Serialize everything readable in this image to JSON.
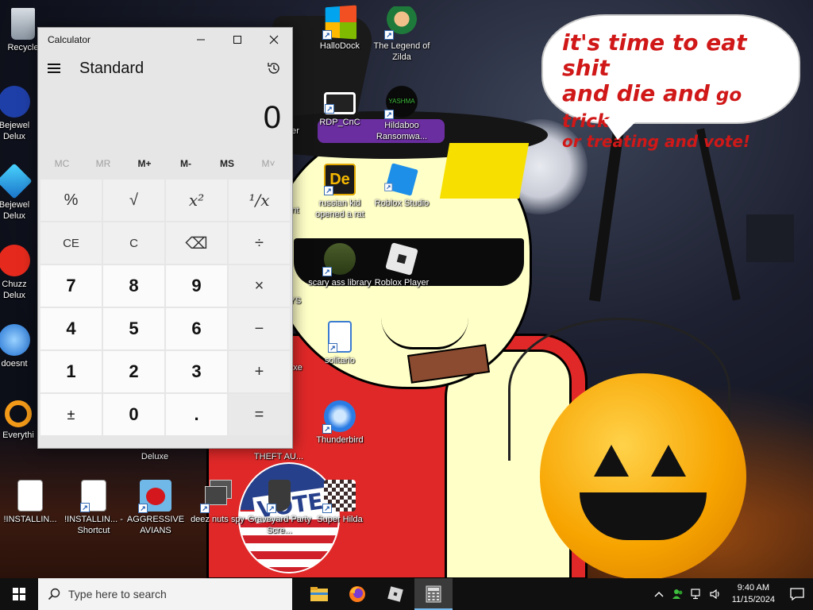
{
  "wallpaper": {
    "speech_line1": "it's time to eat shit",
    "speech_line2_a": "and die and",
    "speech_line2_b": " go trick",
    "speech_line3": "or treating and vote!",
    "vote_text": "VOTE"
  },
  "desktop_icons": [
    {
      "label": "Recycle",
      "icon": "recycle-bin-icon"
    },
    {
      "label": "Bejewel Delux",
      "icon": "bejeweled-icon"
    },
    {
      "label": "Bejewel Delux",
      "icon": "bejeweled-gem-icon"
    },
    {
      "label": "Chuzz Delux",
      "icon": "chuzzle-icon"
    },
    {
      "label": "doesnt",
      "icon": "thunderbird-icon"
    },
    {
      "label": "Everythi",
      "icon": "everything-search-icon"
    },
    {
      "label": "HalloDock",
      "icon": "windows-logo-icon"
    },
    {
      "label": "The Legend of Zilda",
      "icon": "zelda-character-icon"
    },
    {
      "label": "RDP_CnC",
      "icon": "rdp-monitor-icon"
    },
    {
      "label": "Hildaboo Ransomwa...",
      "icon": "yashma-ransomware-icon"
    },
    {
      "label": "russian kid opened a rat",
      "icon": "de-logo-icon"
    },
    {
      "label": "Roblox Studio",
      "icon": "roblox-studio-icon"
    },
    {
      "label": "scary ass library",
      "icon": "library-icon"
    },
    {
      "label": "Roblox Player",
      "icon": "roblox-player-icon"
    },
    {
      "label": "solitario",
      "icon": "solitaire-icon"
    },
    {
      "label": "Thunderbird",
      "icon": "thunderbird-icon"
    },
    {
      "label": "!INSTALLIN...",
      "icon": "text-document-icon"
    },
    {
      "label": "!INSTALLIN... - Shortcut",
      "icon": "text-document-icon"
    },
    {
      "label": "AGGRESSIVE AVIANS",
      "icon": "angry-birds-icon"
    },
    {
      "label": "deez nuts spy",
      "icon": "stacked-windows-icon"
    },
    {
      "label": "Graveyard Party Scre...",
      "icon": "graveyard-icon"
    },
    {
      "label": "Super Hilda",
      "icon": "super-hilda-icon"
    },
    {
      "label": "THEFT AU...",
      "icon": "gta-icon"
    },
    {
      "label": "Deluxe",
      "icon": "game-icon"
    },
    {
      "label": "er",
      "icon": "partial-icon"
    },
    {
      "label": "nt",
      "icon": "partial-icon"
    },
    {
      "label": "YS",
      "icon": "partial-icon"
    },
    {
      "label": "exe",
      "icon": "partial-icon"
    }
  ],
  "calculator": {
    "window_title": "Calculator",
    "mode": "Standard",
    "display_value": "0",
    "memory": [
      "MC",
      "MR",
      "M+",
      "M-",
      "MS",
      "M˅"
    ],
    "keys": [
      "%",
      "√",
      "x²",
      "¹/x",
      "CE",
      "C",
      "⌫",
      "÷",
      "7",
      "8",
      "9",
      "×",
      "4",
      "5",
      "6",
      "−",
      "1",
      "2",
      "3",
      "+",
      "±",
      "0",
      ".",
      "="
    ]
  },
  "taskbar": {
    "search_placeholder": "Type here to search",
    "time": "9:40 AM",
    "date": "11/15/2024",
    "apps": [
      "file-explorer-icon",
      "firefox-icon",
      "roblox-icon",
      "calculator-icon"
    ]
  },
  "colors": {
    "speech_red": "#d01818",
    "taskbar": "#101010",
    "calc_bg": "#e6e6e6",
    "active_underline": "#76b9ed"
  }
}
